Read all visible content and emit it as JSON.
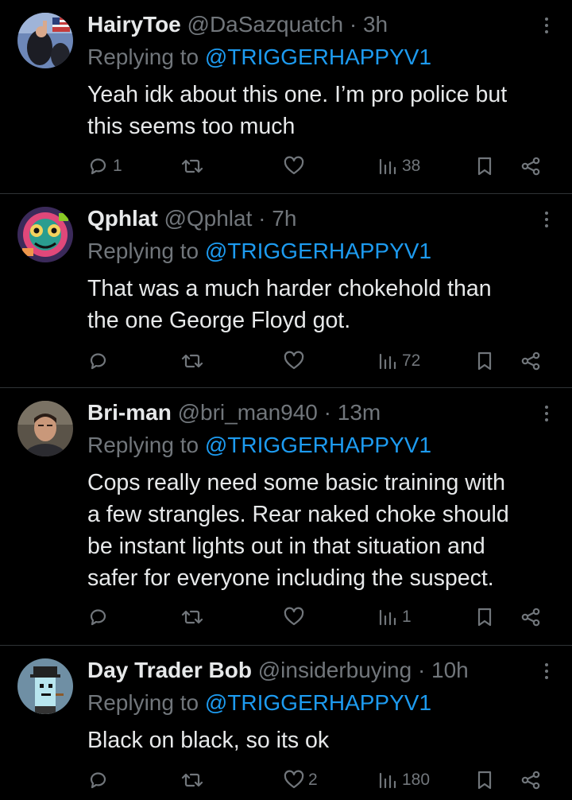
{
  "colors": {
    "background": "#000000",
    "text": "#e7e9ea",
    "muted": "#71767b",
    "link": "#1d9bf0",
    "divider": "#2f3336"
  },
  "tweets": [
    {
      "name": "HairyToe",
      "handle": "@DaSazquatch",
      "time": "· 3h",
      "replying_prefix": "Replying to",
      "replying_to": "@TRIGGERHAPPYV1",
      "text_lines": [
        "Yeah idk about this one. I’m pro police but",
        "this seems too much"
      ],
      "reply_count": "1",
      "retweet_count": "",
      "like_count": "",
      "view_count": "38",
      "avatar_icon": "avatar-photo-flag"
    },
    {
      "name": "Qphlat",
      "handle": "@Qphlat",
      "time": "· 7h",
      "replying_prefix": "Replying to",
      "replying_to": "@TRIGGERHAPPYV1",
      "text_lines": [
        "That was a much harder chokehold than",
        "the one George Floyd got."
      ],
      "reply_count": "",
      "retweet_count": "",
      "like_count": "",
      "view_count": "72",
      "avatar_icon": "avatar-colorful-art"
    },
    {
      "name": "Bri-man",
      "handle": "@bri_man940",
      "time": "· 13m",
      "replying_prefix": "Replying to",
      "replying_to": "@TRIGGERHAPPYV1",
      "text_lines": [
        "Cops really need some basic training with",
        "a few strangles. Rear naked choke should",
        "be instant lights out in that situation and",
        "safer for everyone including the suspect."
      ],
      "reply_count": "",
      "retweet_count": "",
      "like_count": "",
      "view_count": "1",
      "avatar_icon": "avatar-photo-face"
    },
    {
      "name": "Day Trader Bob",
      "handle": "@insiderbuying",
      "time": "· 10h",
      "replying_prefix": "Replying to",
      "replying_to": "@TRIGGERHAPPYV1",
      "text_lines": [
        "Black on black, so its ok"
      ],
      "reply_count": "",
      "retweet_count": "",
      "like_count": "2",
      "view_count": "180",
      "avatar_icon": "avatar-pixel-punk"
    }
  ]
}
